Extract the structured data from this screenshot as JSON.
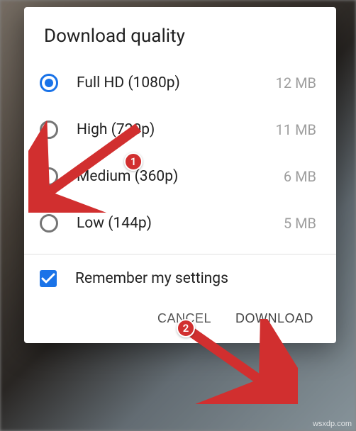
{
  "dialog": {
    "title": "Download quality",
    "options": [
      {
        "label": "Full HD (1080p)",
        "size": "12 MB",
        "selected": true
      },
      {
        "label": "High (720p)",
        "size": "11 MB",
        "selected": false
      },
      {
        "label": "Medium (360p)",
        "size": "6 MB",
        "selected": false
      },
      {
        "label": "Low (144p)",
        "size": "5 MB",
        "selected": false
      }
    ],
    "remember": {
      "label": "Remember my settings",
      "checked": true
    },
    "buttons": {
      "cancel": "CANCEL",
      "download": "DOWNLOAD"
    }
  },
  "annotations": {
    "badge1": "1",
    "badge2": "2"
  },
  "watermark": "wsxdp.com"
}
